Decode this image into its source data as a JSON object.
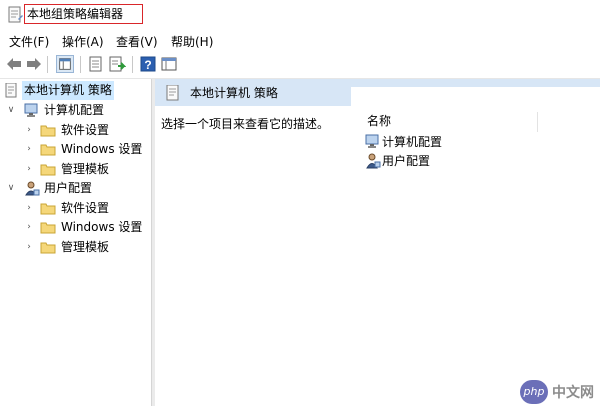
{
  "window": {
    "title": "本地组策略编辑器"
  },
  "menu": [
    {
      "label": "文件(F)"
    },
    {
      "label": "操作(A)"
    },
    {
      "label": "查看(V)"
    },
    {
      "label": "帮助(H)"
    }
  ],
  "toolbar": {
    "buttons": [
      "back-icon",
      "forward-icon",
      "show-hide-tree-icon",
      "export-list-icon",
      "properties-icon",
      "help-icon",
      "extended-view-icon"
    ]
  },
  "tree": [
    {
      "label": "本地计算机 策略",
      "level": 0,
      "expanded": null,
      "icon": "policy-icon",
      "selected": true
    },
    {
      "label": "计算机配置",
      "level": 1,
      "expanded": true,
      "icon": "computer-config-icon"
    },
    {
      "label": "软件设置",
      "level": 2,
      "expanded": false,
      "icon": "folder-icon"
    },
    {
      "label": "Windows 设置",
      "level": 2,
      "expanded": false,
      "icon": "folder-icon"
    },
    {
      "label": "管理模板",
      "level": 2,
      "expanded": false,
      "icon": "folder-icon"
    },
    {
      "label": "用户配置",
      "level": 1,
      "expanded": true,
      "icon": "user-config-icon"
    },
    {
      "label": "软件设置",
      "level": 2,
      "expanded": false,
      "icon": "folder-icon"
    },
    {
      "label": "Windows 设置",
      "level": 2,
      "expanded": false,
      "icon": "folder-icon"
    },
    {
      "label": "管理模板",
      "level": 2,
      "expanded": false,
      "icon": "folder-icon"
    }
  ],
  "detail": {
    "header": "本地计算机 策略",
    "description": "选择一个项目来查看它的描述。",
    "column_name": "名称",
    "items": [
      {
        "label": "计算机配置",
        "icon": "computer-config-icon"
      },
      {
        "label": "用户配置",
        "icon": "user-config-icon"
      }
    ]
  },
  "watermark": {
    "badge": "php",
    "text": "中文网"
  },
  "colors": {
    "title_highlight": "#d9262a",
    "header_band": "#d7e6f6",
    "selection": "#cce8ff"
  }
}
